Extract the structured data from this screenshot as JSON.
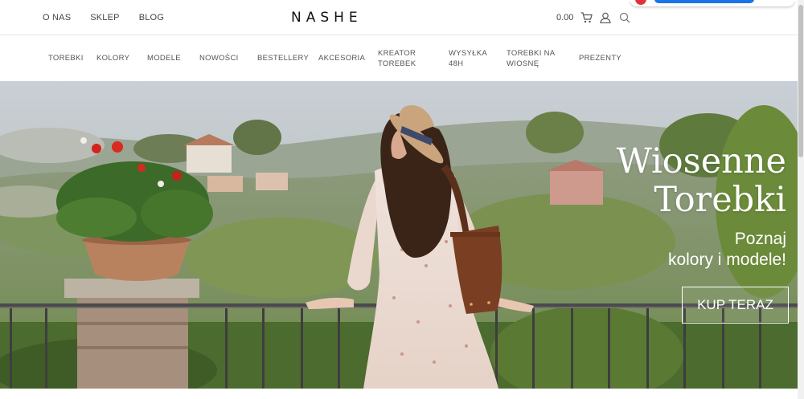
{
  "top_nav": {
    "links": [
      "O NAS",
      "SKLEP",
      "BLOG"
    ],
    "logo": "NASHE",
    "cart_total": "0.00",
    "icons": [
      "cart-icon",
      "user-icon",
      "search-icon"
    ]
  },
  "main_nav": {
    "items": [
      {
        "label": "TOREBKI"
      },
      {
        "label": "KOLORY"
      },
      {
        "label": "MODELE"
      },
      {
        "label": "NOWOŚCI"
      },
      {
        "label": "BESTELLERY"
      },
      {
        "label": "AKCESORIA"
      },
      {
        "label": "KREATOR TOREBEK"
      },
      {
        "label": "WYSYŁKA 48H"
      },
      {
        "label": "TOREBKI NA WIOSNĘ"
      },
      {
        "label": "PREZENTY"
      }
    ]
  },
  "hero": {
    "title_line1": "Wiosenne",
    "title_line2": "Torebki",
    "subtitle_line1": "Poznaj",
    "subtitle_line2": "kolory i modele!",
    "cta_label": "KUP TERAZ"
  },
  "colors": {
    "text": "#333333",
    "accent_white": "#ffffff",
    "hero_green": "#8fa070"
  }
}
